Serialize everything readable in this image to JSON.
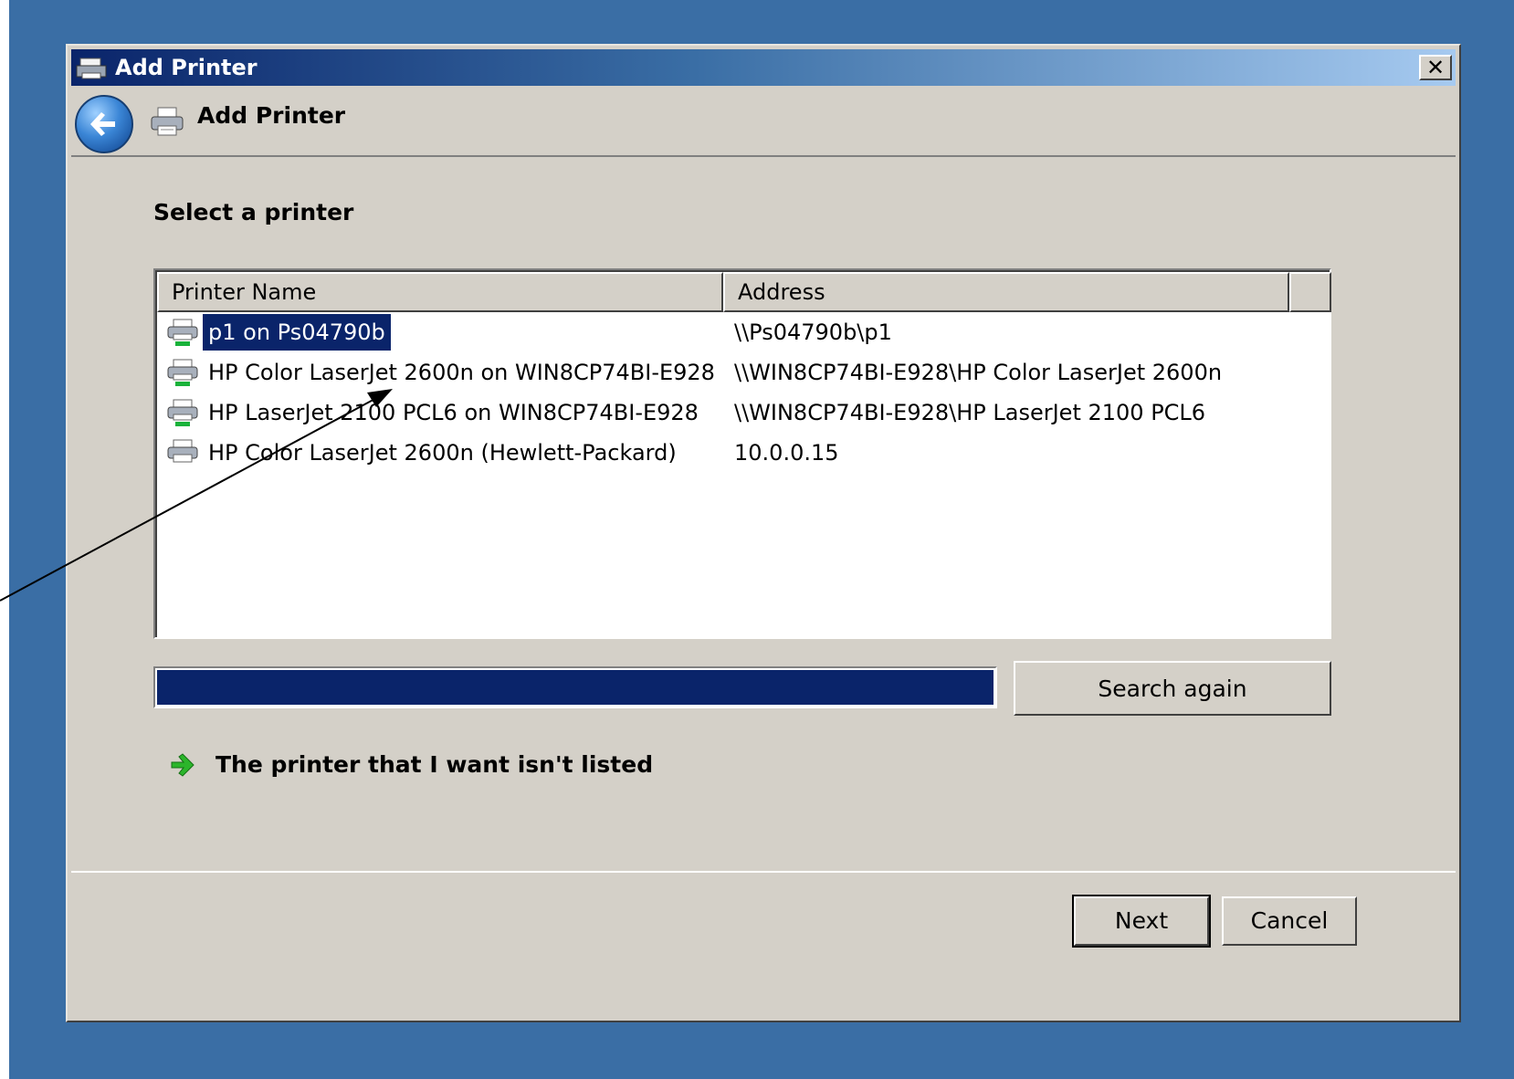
{
  "window": {
    "title": "Add Printer",
    "close_label": "✕"
  },
  "header": {
    "title": "Add Printer"
  },
  "content": {
    "prompt": "Select a printer",
    "columns": [
      "Printer Name",
      "Address"
    ],
    "printers": [
      {
        "name": "p1 on Ps04790b",
        "address": "\\\\Ps04790b\\p1",
        "selected": true
      },
      {
        "name": "HP Color LaserJet 2600n on WIN8CP74BI-E928",
        "address": "\\\\WIN8CP74BI-E928\\HP Color LaserJet 2600n",
        "selected": false
      },
      {
        "name": "HP LaserJet 2100 PCL6 on WIN8CP74BI-E928",
        "address": "\\\\WIN8CP74BI-E928\\HP LaserJet 2100 PCL6",
        "selected": false
      },
      {
        "name": "HP Color LaserJet 2600n (Hewlett-Packard)",
        "address": "10.0.0.15",
        "selected": false
      }
    ],
    "search_progress": 1.0,
    "search_again_label": "Search again",
    "not_listed_label": "The printer that I want isn't listed"
  },
  "footer": {
    "next_label": "Next",
    "cancel_label": "Cancel"
  },
  "colors": {
    "desktop": "#3a6ea5",
    "selection": "#0a246a",
    "progress": "#0a246a"
  }
}
